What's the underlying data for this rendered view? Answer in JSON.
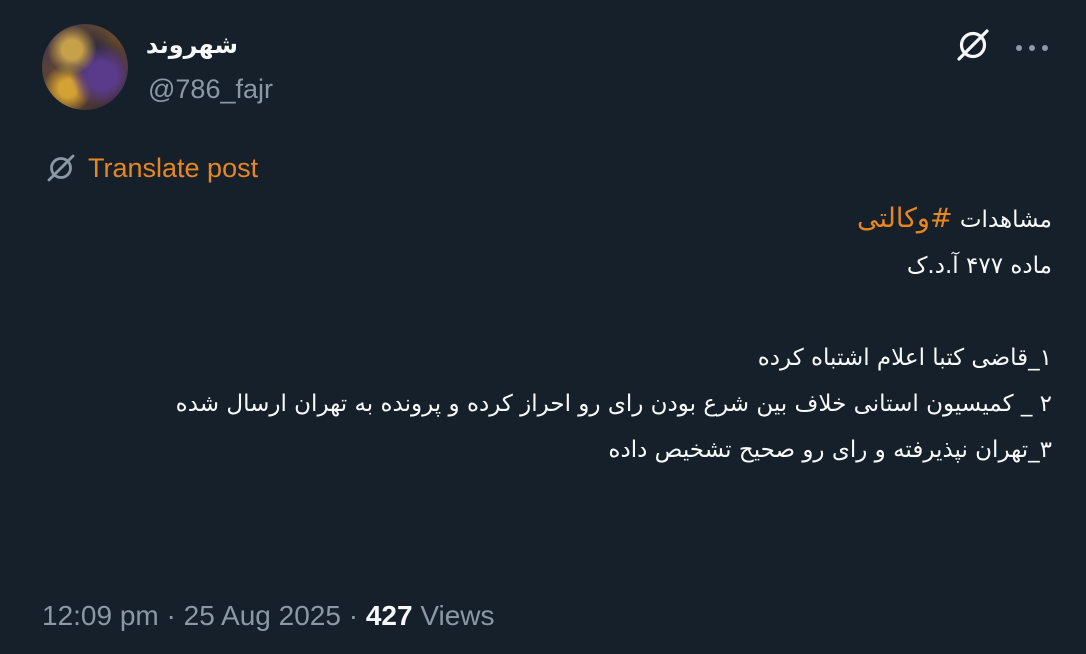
{
  "author": {
    "display_name": "شهروند",
    "handle": "@786_fajr",
    "avatar_icon": "avatar-image"
  },
  "actions": {
    "grok_icon": "grok-icon",
    "more_icon": "more-options-icon"
  },
  "translate": {
    "icon": "translate-icon",
    "label": "Translate post"
  },
  "post": {
    "line1_text": "مشاهدات ",
    "line1_hashtag": "#وکالتی",
    "line2": "ماده ۴۷۷  آ.د.ک",
    "line3": "۱_قاضی کتبا اعلام اشتباه کرده",
    "line4": "۲ _ کمیسیون استانی خلاف بین شرع بودن رای رو احراز کرده و پرونده به تهران ارسال شده",
    "line5": "۳_تهران نپذیرفته و رای رو صحیح تشخیص داده"
  },
  "meta": {
    "time": "12:09 pm",
    "separator": "·",
    "date": "25 Aug 2025",
    "views_count": "427",
    "views_label": "Views"
  },
  "colors": {
    "background": "#15202b",
    "accent": "#e8861f",
    "text": "#f7f9f9",
    "secondary": "#8b98a5"
  }
}
